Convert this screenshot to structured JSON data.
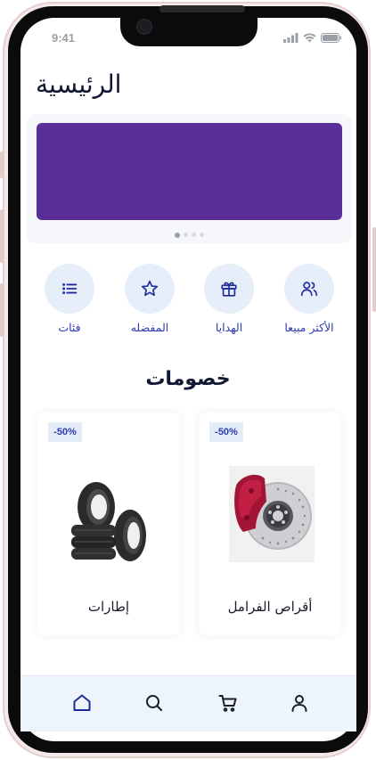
{
  "status_bar": {
    "time": "9:41"
  },
  "header": {
    "title": "الرئيسية"
  },
  "banner": {
    "color": "#5a2e98",
    "slide_count": 4,
    "active_slide": 1
  },
  "categories": [
    {
      "label": "الأكثر مبيعا",
      "icon": "users-icon"
    },
    {
      "label": "الهدايا",
      "icon": "gift-icon"
    },
    {
      "label": "المفضله",
      "icon": "star-icon"
    },
    {
      "label": "فئات",
      "icon": "list-icon"
    }
  ],
  "discounts": {
    "title": "خصومات",
    "products": [
      {
        "name": "أقراص الفرامل",
        "badge": "-50%",
        "image": "brake-disc-image"
      },
      {
        "name": "إطارات",
        "badge": "-50%",
        "image": "tires-image"
      }
    ]
  },
  "bottom_nav": {
    "items": [
      "home-icon",
      "search-icon",
      "cart-icon",
      "profile-icon"
    ],
    "active": "home-icon"
  },
  "colors": {
    "accent": "#2b3bb0",
    "title": "#0f1733",
    "chip_bg": "#e6eef9"
  }
}
